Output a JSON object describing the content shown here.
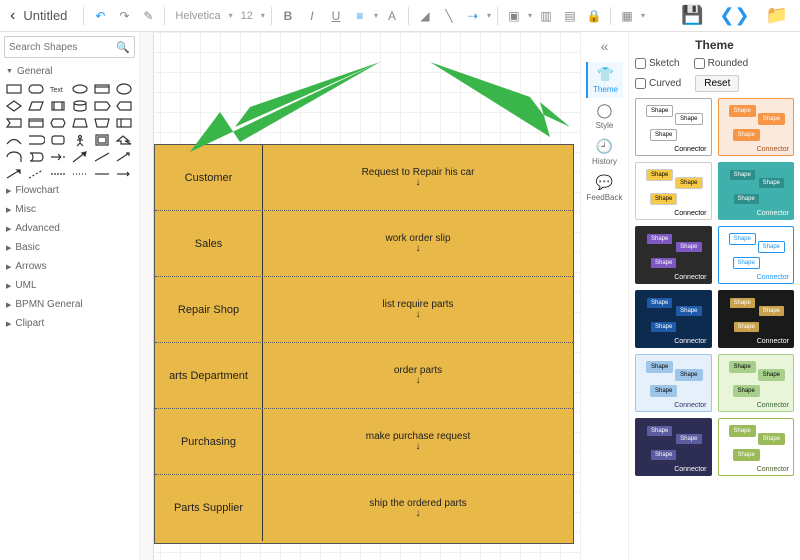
{
  "topbar": {
    "title": "Untitled",
    "font_family": "Helvetica",
    "font_size": "12"
  },
  "search": {
    "placeholder": "Search Shapes"
  },
  "shape_categories": {
    "open": "General",
    "closed": [
      "Flowchart",
      "Misc",
      "Advanced",
      "Basic",
      "Arrows",
      "UML",
      "BPMN General",
      "Clipart"
    ]
  },
  "swimlanes": [
    {
      "title": "Customer",
      "text": "Request to Repair his car"
    },
    {
      "title": "Sales",
      "text": "work order slip"
    },
    {
      "title": "Repair Shop",
      "text": "list require parts"
    },
    {
      "title": "arts Department",
      "text": "order parts"
    },
    {
      "title": "Purchasing",
      "text": "make purchase request"
    },
    {
      "title": "Parts Supplier",
      "text": "ship the ordered parts"
    }
  ],
  "mini_panel": {
    "items": [
      {
        "icon": "👕",
        "label": "Theme",
        "active": true
      },
      {
        "icon": "◯",
        "label": "Style"
      },
      {
        "icon": "🕘",
        "label": "History"
      },
      {
        "icon": "💬",
        "label": "FeedBack"
      }
    ]
  },
  "theme_panel": {
    "title": "Theme",
    "opts": {
      "sketch": "Sketch",
      "rounded": "Rounded",
      "curved": "Curved"
    },
    "reset": "Reset",
    "themes": [
      {
        "bg": "#ffffff",
        "n1bg": "#fff",
        "n1c": "#000",
        "n2bg": "#fff",
        "n2c": "#000",
        "cap": "#000",
        "border": "#aaa"
      },
      {
        "bg": "#fbe9dc",
        "n1bg": "#f79646",
        "n1c": "#fff",
        "n2bg": "#f79646",
        "n2c": "#fff",
        "cap": "#a05020",
        "border": "#f79646"
      },
      {
        "bg": "#ffffff",
        "n1bg": "#f7c948",
        "n1c": "#000",
        "n2bg": "#f7c948",
        "n2c": "#000",
        "cap": "#000",
        "border": "#ccc"
      },
      {
        "bg": "#3fb0ac",
        "n1bg": "#2d8f8b",
        "n1c": "#fff",
        "n2bg": "#2d8f8b",
        "n2c": "#fff",
        "cap": "#fff",
        "border": "#3fb0ac"
      },
      {
        "bg": "#2b2b2b",
        "n1bg": "#7e57c2",
        "n1c": "#fff",
        "n2bg": "#7e57c2",
        "n2c": "#fff",
        "cap": "#fff",
        "border": "#2b2b2b"
      },
      {
        "bg": "#ffffff",
        "n1bg": "#fff",
        "n1c": "#2196f3",
        "n2bg": "#fff",
        "n2c": "#2196f3",
        "cap": "#2196f3",
        "border": "#2196f3"
      },
      {
        "bg": "#0d2b4e",
        "n1bg": "#1e5aa8",
        "n1c": "#fff",
        "n2bg": "#1e5aa8",
        "n2c": "#fff",
        "cap": "#fff",
        "border": "#0d2b4e"
      },
      {
        "bg": "#1a1a1a",
        "n1bg": "#c9a14a",
        "n1c": "#fff",
        "n2bg": "#c9a14a",
        "n2c": "#fff",
        "cap": "#fff",
        "border": "#1a1a1a"
      },
      {
        "bg": "#e6f0fa",
        "n1bg": "#9fc5e8",
        "n1c": "#000",
        "n2bg": "#9fc5e8",
        "n2c": "#000",
        "cap": "#336",
        "border": "#9fc5e8"
      },
      {
        "bg": "#e8f5d8",
        "n1bg": "#a8d08d",
        "n1c": "#000",
        "n2bg": "#a8d08d",
        "n2c": "#000",
        "cap": "#363",
        "border": "#a8d08d"
      },
      {
        "bg": "#2e2e54",
        "n1bg": "#5c5ca0",
        "n1c": "#fff",
        "n2bg": "#5c5ca0",
        "n2c": "#fff",
        "cap": "#fff",
        "border": "#2e2e54"
      },
      {
        "bg": "#ffffff",
        "n1bg": "#9bbb59",
        "n1c": "#fff",
        "n2bg": "#9bbb59",
        "n2c": "#fff",
        "cap": "#4a5d2c",
        "border": "#9bbb59"
      }
    ],
    "thumb": {
      "shape": "Shape",
      "connector": "Connector"
    }
  }
}
